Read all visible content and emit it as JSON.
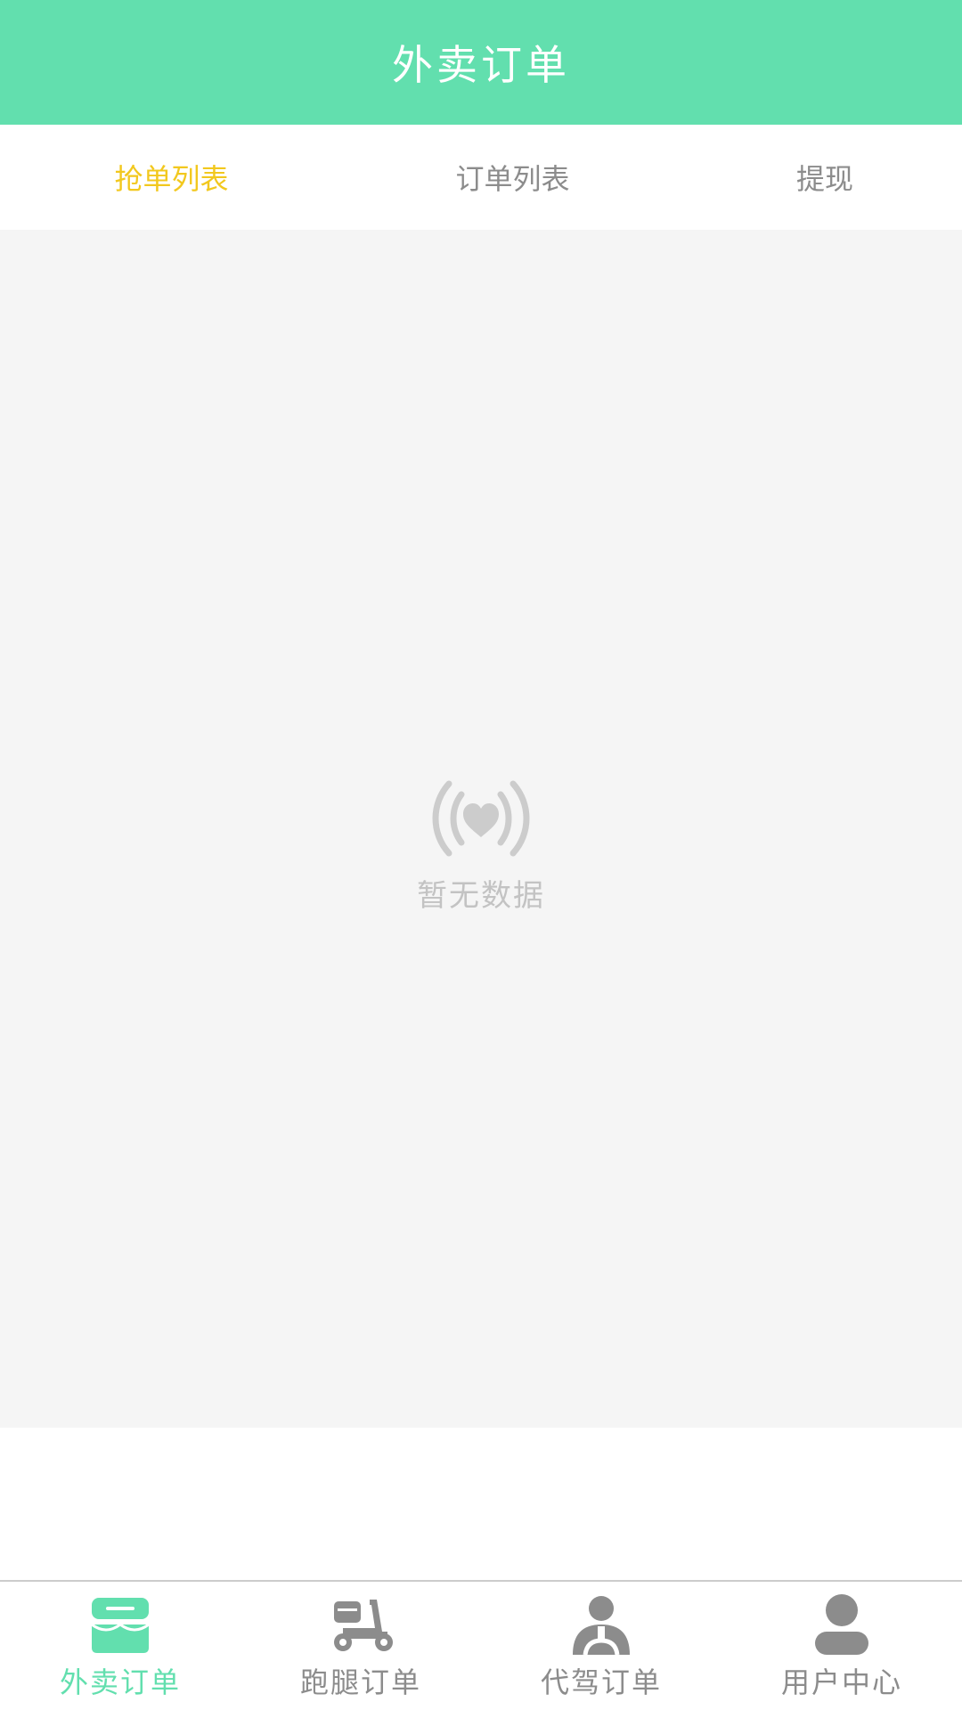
{
  "header": {
    "title": "外卖订单"
  },
  "tabs": [
    {
      "label": "抢单列表",
      "active": true
    },
    {
      "label": "订单列表",
      "active": false
    },
    {
      "label": "提现",
      "active": false
    }
  ],
  "empty_state": {
    "icon": "signal-heart-icon",
    "text": "暂无数据"
  },
  "bottom_nav": [
    {
      "label": "外卖订单",
      "icon": "store-icon",
      "active": true
    },
    {
      "label": "跑腿订单",
      "icon": "scooter-icon",
      "active": false
    },
    {
      "label": "代驾订单",
      "icon": "driver-icon",
      "active": false
    },
    {
      "label": "用户中心",
      "icon": "user-icon",
      "active": false
    }
  ],
  "colors": {
    "primary": "#62dfae",
    "active_tab": "#f2c81e",
    "inactive_text": "#8c8c8c",
    "content_bg": "#f5f5f5",
    "empty_text": "#c3c3c3"
  }
}
